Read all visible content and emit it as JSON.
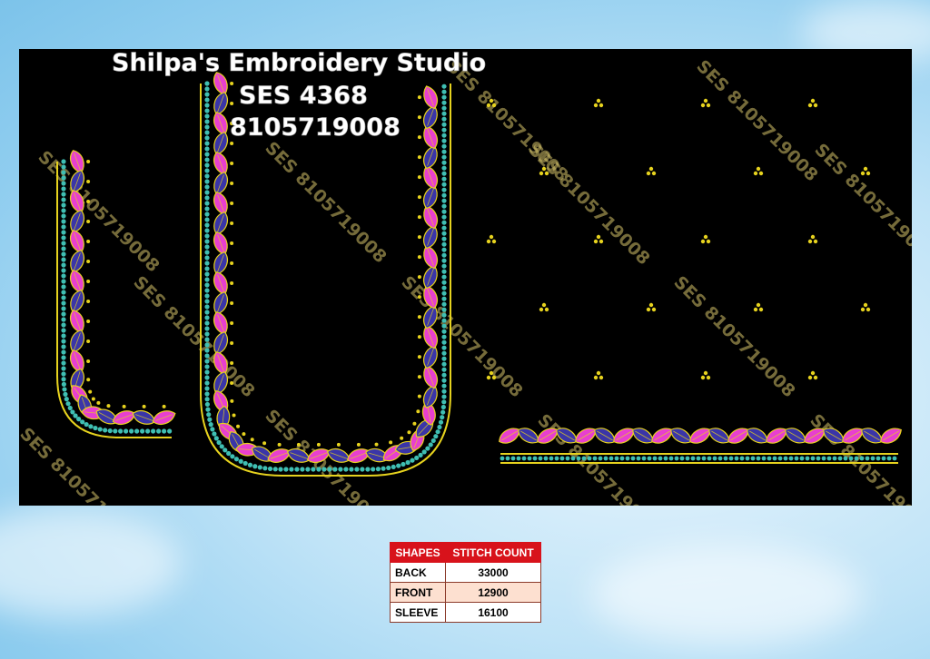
{
  "header": {
    "studio_name": "Shilpa's Embroidery Studio",
    "design_code": "SES 4368",
    "phone": "8105719008"
  },
  "watermark_text": "SES 8105719008",
  "table": {
    "headers": [
      "SHAPES",
      "STITCH COUNT"
    ],
    "rows": [
      {
        "shape": "BACK",
        "count": "33000"
      },
      {
        "shape": "FRONT",
        "count": "12900"
      },
      {
        "shape": "SLEEVE",
        "count": "16100"
      }
    ]
  },
  "colors": {
    "leaf_pink": "#e83fd0",
    "leaf_blue": "#3a35a8",
    "bead_teal": "#3fbfb3",
    "gold_thread": "#e6d21e",
    "canvas_bg": "#000000",
    "table_header": "#d8121b"
  }
}
